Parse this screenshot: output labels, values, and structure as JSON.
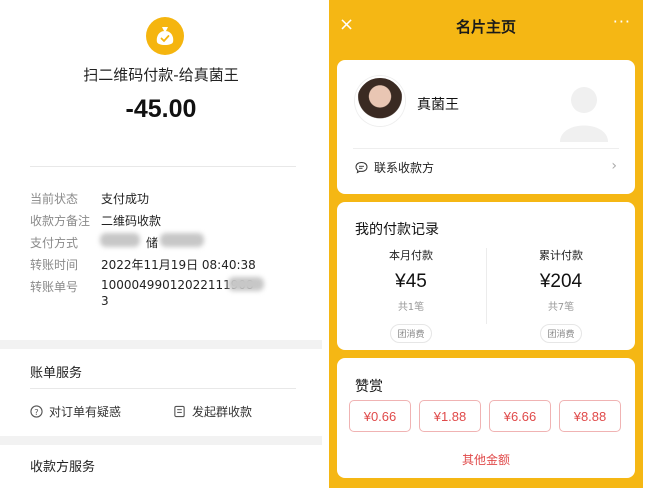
{
  "left": {
    "payment_title": "扫二维码付款-给真菌王",
    "amount": "-45.00",
    "details": [
      {
        "label": "当前状态",
        "value": "支付成功"
      },
      {
        "label": "收款方备注",
        "value": "二维码收款"
      },
      {
        "label": "支付方式",
        "value": "储"
      },
      {
        "label": "转账时间",
        "value": "2022年11月19日 08:40:38"
      },
      {
        "label": "转账单号",
        "value": "10000499012022111908",
        "value_line2": "3"
      }
    ],
    "bill_service_title": "账单服务",
    "services": [
      {
        "label": "对订单有疑惑",
        "icon": "question-icon"
      },
      {
        "label": "发起群收款",
        "icon": "group-collect-icon"
      }
    ],
    "payee_service_title": "收款方服务"
  },
  "right": {
    "header_title": "名片主页",
    "close_icon": "×",
    "more_icon": "···",
    "name": "真菌王",
    "contact_label": "联系收款方",
    "records_title": "我的付款记录",
    "month": {
      "label": "本月付款",
      "amount": "¥45",
      "count": "共1笔",
      "chip": "团消费"
    },
    "total": {
      "label": "累计付款",
      "amount": "¥204",
      "count": "共7笔",
      "chip": "团消费"
    },
    "reward_title": "赞赏",
    "reward_options": [
      "¥0.66",
      "¥1.88",
      "¥6.66",
      "¥8.88"
    ],
    "other_amount": "其他金额",
    "accent_color": "#f5b714",
    "red_color": "#e04a4a"
  }
}
